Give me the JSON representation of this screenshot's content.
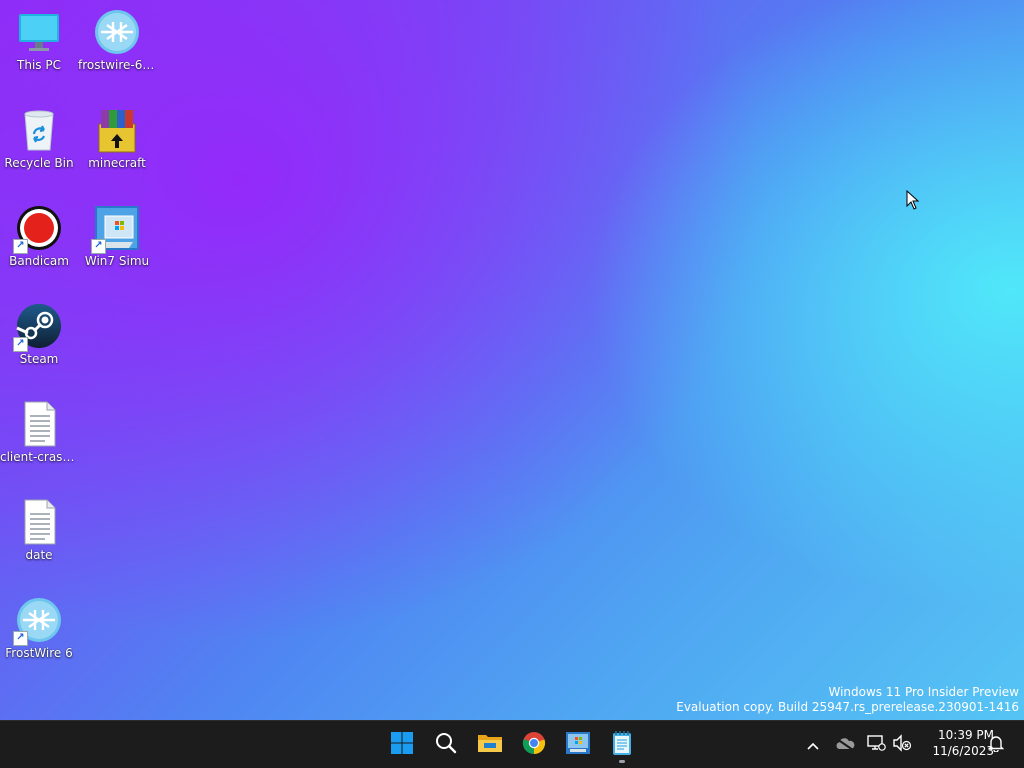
{
  "desktop": {
    "icons": [
      {
        "label": "This PC",
        "icon": "this-pc-icon"
      },
      {
        "label": "frostwire-6....",
        "icon": "frostwire-icon"
      },
      {
        "label": "Recycle Bin",
        "icon": "recycle-bin-icon"
      },
      {
        "label": "minecraft",
        "icon": "winrar-archive-icon"
      },
      {
        "label": "Bandicam",
        "icon": "bandicam-icon"
      },
      {
        "label": "Win7 Simu",
        "icon": "win7-simu-icon"
      },
      {
        "label": "Steam",
        "icon": "steam-icon"
      },
      {
        "label": "client-crash...",
        "icon": "text-file-icon"
      },
      {
        "label": "date",
        "icon": "text-file-icon"
      },
      {
        "label": "FrostWire 6",
        "icon": "frostwire-icon"
      }
    ]
  },
  "watermark": {
    "line1": "Windows 11 Pro Insider Preview",
    "line2": "Evaluation copy. Build 25947.rs_prerelease.230901-1416"
  },
  "taskbar": {
    "apps": [
      "start-icon",
      "search-icon",
      "file-explorer-icon",
      "chrome-icon",
      "win7-simu-icon",
      "notepad-icon"
    ],
    "tray": [
      "chevron-up-icon",
      "onedrive-icon",
      "network-icon",
      "volume-muted-icon",
      "notification-bell-icon"
    ],
    "time": "10:39 PM",
    "date": "11/6/2023"
  },
  "colors": {
    "taskbar_bg": "#1c1c1c",
    "accent": "#0078d4",
    "wallpaper_start": "#8a2ff5",
    "wallpaper_end": "#56c8f4"
  }
}
